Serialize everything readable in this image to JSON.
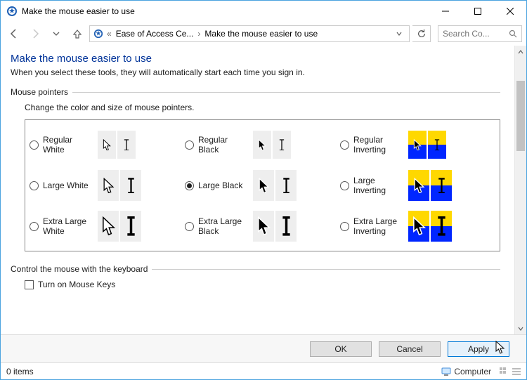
{
  "titlebar": {
    "title": "Make the mouse easier to use"
  },
  "breadcrumb": {
    "crumb1": "Ease of Access Ce...",
    "crumb2": "Make the mouse easier to use"
  },
  "search": {
    "placeholder": "Search Co..."
  },
  "page": {
    "heading": "Make the mouse easier to use",
    "subhead": "When you select these tools, they will automatically start each time you sign in."
  },
  "group1": {
    "label": "Mouse pointers",
    "desc": "Change the color and size of mouse pointers."
  },
  "pointers": {
    "selected": "large_black",
    "options": {
      "regular_white": {
        "label": "Regular\nWhite",
        "style": "white",
        "size": "s"
      },
      "regular_black": {
        "label": "Regular\nBlack",
        "style": "black",
        "size": "s"
      },
      "regular_inv": {
        "label": "Regular\nInverting",
        "style": "inv",
        "size": "s"
      },
      "large_white": {
        "label": "Large White",
        "style": "white",
        "size": "m"
      },
      "large_black": {
        "label": "Large Black",
        "style": "black",
        "size": "m"
      },
      "large_inv": {
        "label": "Large\nInverting",
        "style": "inv",
        "size": "m"
      },
      "xlarge_white": {
        "label": "Extra Large\nWhite",
        "style": "white",
        "size": "l"
      },
      "xlarge_black": {
        "label": "Extra Large\nBlack",
        "style": "black",
        "size": "l"
      },
      "xlarge_inv": {
        "label": "Extra Large\nInverting",
        "style": "inv",
        "size": "l"
      }
    }
  },
  "group2": {
    "label": "Control the mouse with the keyboard",
    "check1": "Turn on Mouse Keys"
  },
  "buttons": {
    "ok": "OK",
    "cancel": "Cancel",
    "apply": "Apply"
  },
  "status": {
    "items": "0 items",
    "computer": "Computer"
  }
}
